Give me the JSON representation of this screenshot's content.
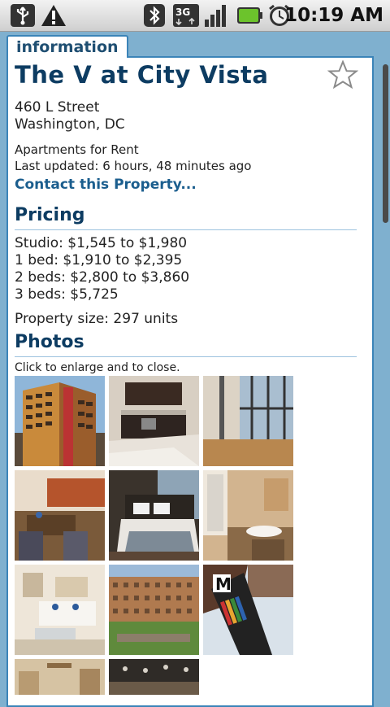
{
  "status_bar": {
    "time": "10:19 AM",
    "network": "3G"
  },
  "tab": {
    "label": "information"
  },
  "property": {
    "name": "The V at City Vista",
    "address_line1": "460 L Street",
    "address_line2": "Washington, DC",
    "category": "Apartments for Rent",
    "last_updated": "Last updated: 6 hours, 48 minutes ago",
    "contact_link": "Contact this Property..."
  },
  "pricing": {
    "heading": "Pricing",
    "rows": [
      "Studio: $1,545 to $1,980",
      "1 bed: $1,910 to $2,395",
      "2 beds: $2,800 to $3,860",
      "3 beds: $5,725"
    ],
    "size": "Property size: 297 units"
  },
  "photos": {
    "heading": "Photos",
    "hint": "Click to enlarge and to close.",
    "items": [
      {
        "label": "building-exterior"
      },
      {
        "label": "kitchen"
      },
      {
        "label": "living-room-windows"
      },
      {
        "label": "dining-area"
      },
      {
        "label": "bedroom"
      },
      {
        "label": "bathroom"
      },
      {
        "label": "lounge"
      },
      {
        "label": "courtyard"
      },
      {
        "label": "metro-sign"
      },
      {
        "label": "interior-1"
      },
      {
        "label": "interior-2"
      }
    ]
  },
  "colors": {
    "accent": "#3b84b8",
    "heading": "#0d3c62",
    "link": "#1b5e8e"
  }
}
